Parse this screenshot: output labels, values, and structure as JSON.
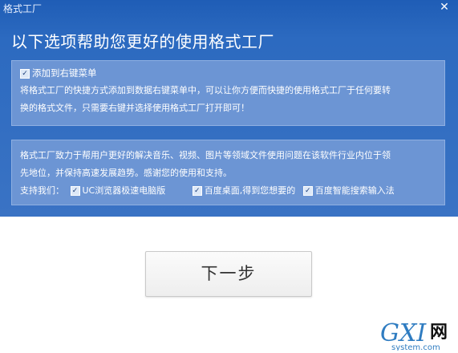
{
  "window": {
    "title": "格式工厂"
  },
  "headline": "以下选项帮助您更好的使用格式工厂",
  "panel1": {
    "checkbox_label": "添加到右键菜单",
    "line1": "将格式工厂的快捷方式添加到数据右键菜单中，可以让你方便而快捷的使用格式工厂于任何要转",
    "line2": "换的格式文件，只需要右键并选择使用格式工厂打开即可！"
  },
  "panel2": {
    "line1": "格式工厂致力于帮用户更好的解决音乐、视频、图片等领域文件使用问题在该软件行业内位于领",
    "line2": "先地位，并保持高速发展趋势。感谢您的使用和支持。",
    "support_label": "支持我们：",
    "options": [
      {
        "label": "UC浏览器极速电脑版",
        "checked": true
      },
      {
        "label": "百度桌面,得到您想要的",
        "checked": true
      },
      {
        "label": "百度智能搜索输入法",
        "checked": true
      }
    ]
  },
  "next_button": "下一步",
  "watermark": {
    "brand": "GXI",
    "cjk": "网",
    "domain": "system.com"
  },
  "colors": {
    "header_blue": "#2c6ac0",
    "panel_blue": "#6c95d4",
    "button_bg": "#f4f4f4"
  }
}
